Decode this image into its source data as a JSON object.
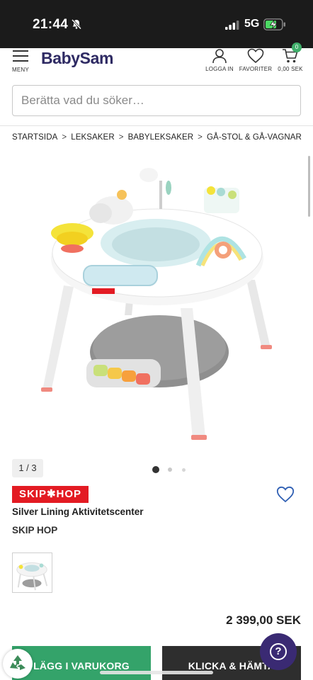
{
  "status_bar": {
    "time": "21:44",
    "network": "5G"
  },
  "header": {
    "menu_label": "MENY",
    "logo_text": "BabySam",
    "login_label": "LOGGA IN",
    "favorites_label": "FAVORITER",
    "cart_total": "0,00 SEK",
    "cart_count": "0"
  },
  "search": {
    "placeholder": "Berätta vad du söker…"
  },
  "breadcrumb": [
    "STARTSIDA",
    "LEKSAKER",
    "BABYLEKSAKER",
    "GÅ-STOL & GÅ-VAGNAR"
  ],
  "gallery": {
    "counter": "1 / 3",
    "current": 1,
    "total": 3
  },
  "product": {
    "brand_logo_text": "SKIP✱HOP",
    "title": "Silver Lining Aktivitetscenter",
    "brand": "SKIP HOP",
    "price": "2 399,00 SEK"
  },
  "actions": {
    "add_to_cart": "LÄGG I VARUKORG",
    "click_collect": "KLICKA & HÄMTA"
  },
  "colors": {
    "brand_purple": "#2e2a63",
    "cart_green": "#34a36a",
    "skiphop_red": "#e31b23",
    "help_purple": "#3a2a73"
  }
}
